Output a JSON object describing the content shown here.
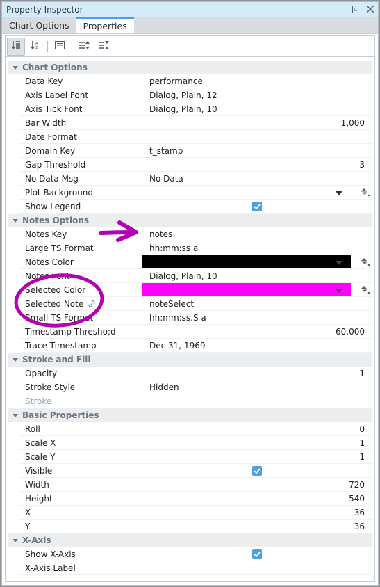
{
  "window": {
    "title": "Property Inspector",
    "icons": [
      "restore-icon",
      "close-icon"
    ]
  },
  "tabs": [
    {
      "label": "Chart Options",
      "active": false
    },
    {
      "label": "Properties",
      "active": true
    }
  ],
  "toolbar": {
    "buttons": [
      {
        "icon": "sort-categorized-icon",
        "active": true
      },
      {
        "icon": "sort-alphabetical-icon",
        "active": false
      },
      {
        "icon": "description-icon",
        "active": false
      },
      {
        "icon": "expand-all-icon",
        "active": false
      },
      {
        "icon": "collapse-all-icon",
        "active": false
      }
    ]
  },
  "colors": {
    "accent": "#4aa3df",
    "notes_color": "#000000",
    "selected_color": "#ff00ff",
    "annotation": "#b300b3"
  },
  "sections": {
    "chart_options": {
      "title": "Chart Options",
      "rows": [
        {
          "key": "Data Key",
          "value": "performance"
        },
        {
          "key": "Axis Label Font",
          "value": "Dialog, Plain, 12"
        },
        {
          "key": "Axis Tick Font",
          "value": "Dialog, Plain, 10"
        },
        {
          "key": "Bar Width",
          "value": "1,000"
        },
        {
          "key": "Date Format",
          "value": ""
        },
        {
          "key": "Domain Key",
          "value": "t_stamp"
        },
        {
          "key": "Gap Threshold",
          "value": "3"
        },
        {
          "key": "No Data Msg",
          "value": "No Data"
        },
        {
          "key": "Plot Background",
          "value": ""
        },
        {
          "key": "Show Legend",
          "value": true
        }
      ]
    },
    "notes_options": {
      "title": "Notes Options",
      "rows": [
        {
          "key": "Notes Key",
          "value": "notes"
        },
        {
          "key": "Large TS Format",
          "value": "hh:mm:ss a"
        },
        {
          "key": "Notes Color",
          "value": "#000000"
        },
        {
          "key": "Notes Font",
          "value": "Dialog, Plain, 10"
        },
        {
          "key": "Selected Color",
          "value": "#ff00ff"
        },
        {
          "key": "Selected Note",
          "value": "noteSelect",
          "bound": true
        },
        {
          "key": "Small TS Format",
          "value": "hh:mm:ss.S a"
        },
        {
          "key": "Timestamp Thresho;d",
          "value": "60,000"
        },
        {
          "key": "Trace Timestamp",
          "value": "Dec 31, 1969"
        }
      ]
    },
    "stroke_fill": {
      "title": "Stroke and Fill",
      "rows": [
        {
          "key": "Opacity",
          "value": "1"
        },
        {
          "key": "Stroke Style",
          "value": "Hidden"
        },
        {
          "key": "Stroke",
          "value": "",
          "disabled": true
        }
      ]
    },
    "basic": {
      "title": "Basic Properties",
      "rows": [
        {
          "key": "Roll",
          "value": "0"
        },
        {
          "key": "Scale X",
          "value": "1"
        },
        {
          "key": "Scale Y",
          "value": "1"
        },
        {
          "key": "Visible",
          "value": true
        },
        {
          "key": "Width",
          "value": "720"
        },
        {
          "key": "Height",
          "value": "540"
        },
        {
          "key": "X",
          "value": "36"
        },
        {
          "key": "Y",
          "value": "36"
        }
      ]
    },
    "x_axis": {
      "title": "X-Axis",
      "rows": [
        {
          "key": "Show X-Axis",
          "value": true
        },
        {
          "key": "X-Axis Label",
          "value": ""
        }
      ]
    }
  }
}
